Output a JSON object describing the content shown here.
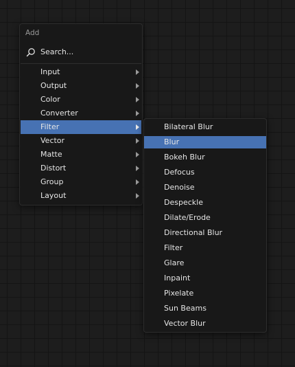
{
  "add_menu": {
    "title": "Add",
    "search": {
      "label": "Search..."
    },
    "items": [
      {
        "label": "Input",
        "active": false
      },
      {
        "label": "Output",
        "active": false
      },
      {
        "label": "Color",
        "active": false
      },
      {
        "label": "Converter",
        "active": false
      },
      {
        "label": "Filter",
        "active": true
      },
      {
        "label": "Vector",
        "active": false
      },
      {
        "label": "Matte",
        "active": false
      },
      {
        "label": "Distort",
        "active": false
      },
      {
        "label": "Group",
        "active": false
      },
      {
        "label": "Layout",
        "active": false
      }
    ]
  },
  "filter_menu": {
    "items": [
      {
        "label": "Bilateral Blur",
        "active": false
      },
      {
        "label": "Blur",
        "active": true
      },
      {
        "label": "Bokeh Blur",
        "active": false
      },
      {
        "label": "Defocus",
        "active": false
      },
      {
        "label": "Denoise",
        "active": false
      },
      {
        "label": "Despeckle",
        "active": false
      },
      {
        "label": "Dilate/Erode",
        "active": false
      },
      {
        "label": "Directional Blur",
        "active": false
      },
      {
        "label": "Filter",
        "active": false
      },
      {
        "label": "Glare",
        "active": false
      },
      {
        "label": "Inpaint",
        "active": false
      },
      {
        "label": "Pixelate",
        "active": false
      },
      {
        "label": "Sun Beams",
        "active": false
      },
      {
        "label": "Vector Blur",
        "active": false
      }
    ]
  },
  "colors": {
    "highlight": "#4772b3",
    "menu_bg": "#181818",
    "canvas_bg": "#1d1d1d",
    "grid": "#141414",
    "text": "#e6e6e6"
  },
  "icons": {
    "search": "search-icon",
    "submenu": "chevron-right-icon"
  }
}
